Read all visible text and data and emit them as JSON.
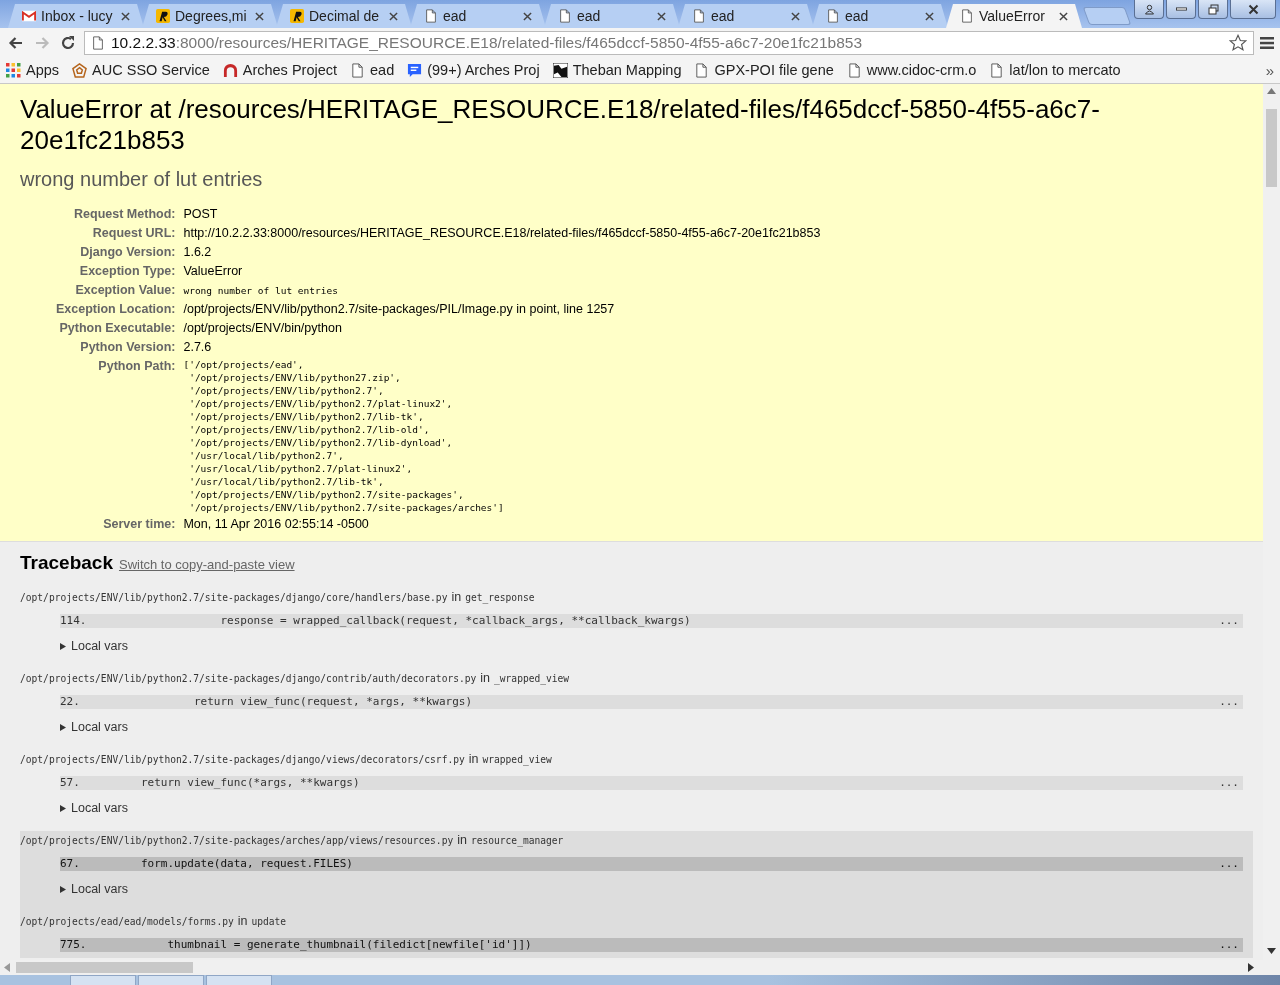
{
  "tabs": [
    {
      "title": "Inbox - lucy",
      "kind": "gmail",
      "selected": false
    },
    {
      "title": "Degrees,mi",
      "kind": "r",
      "selected": false
    },
    {
      "title": "Decimal de",
      "kind": "r",
      "selected": false
    },
    {
      "title": "ead",
      "kind": "page",
      "selected": false
    },
    {
      "title": "ead",
      "kind": "page",
      "selected": false
    },
    {
      "title": "ead",
      "kind": "page",
      "selected": false
    },
    {
      "title": "ead",
      "kind": "page",
      "selected": false
    },
    {
      "title": "ValueError",
      "kind": "page",
      "selected": true
    }
  ],
  "address_bar": {
    "host": "10.2.2.33",
    "path": ":8000/resources/HERITAGE_RESOURCE.E18/related-files/f465dccf-5850-4f55-a6c7-20e1fc21b853"
  },
  "bookmarks": [
    {
      "label": "Apps",
      "kind": "apps"
    },
    {
      "label": "AUC SSO Service",
      "kind": "pentagon"
    },
    {
      "label": "Arches Project",
      "kind": "arch"
    },
    {
      "label": "ead",
      "kind": "page"
    },
    {
      "label": "(99+) Arches Proj",
      "kind": "chat"
    },
    {
      "label": "Theban Mapping",
      "kind": "map"
    },
    {
      "label": "GPX-POI file gene",
      "kind": "page"
    },
    {
      "label": "www.cidoc-crm.o",
      "kind": "page"
    },
    {
      "label": "lat/lon to mercato",
      "kind": "page"
    }
  ],
  "bookmarks_more": "»",
  "error": {
    "title": "ValueError at /resources/HERITAGE_RESOURCE.E18/related-files/f465dccf-5850-4f55-a6c7-20e1fc21b853",
    "message": "wrong number of lut entries"
  },
  "meta": [
    {
      "label": "Request Method:",
      "value": "POST",
      "kind": "text"
    },
    {
      "label": "Request URL:",
      "value": "http://10.2.2.33:8000/resources/HERITAGE_RESOURCE.E18/related-files/f465dccf-5850-4f55-a6c7-20e1fc21b853",
      "kind": "text"
    },
    {
      "label": "Django Version:",
      "value": "1.6.2",
      "kind": "text"
    },
    {
      "label": "Exception Type:",
      "value": "ValueError",
      "kind": "text"
    },
    {
      "label": "Exception Value:",
      "value": "wrong number of lut entries",
      "kind": "code"
    },
    {
      "label": "Exception Location:",
      "value": "/opt/projects/ENV/lib/python2.7/site-packages/PIL/Image.py in point, line 1257",
      "kind": "text"
    },
    {
      "label": "Python Executable:",
      "value": "/opt/projects/ENV/bin/python",
      "kind": "text"
    },
    {
      "label": "Python Version:",
      "value": "2.7.6",
      "kind": "text"
    },
    {
      "label": "Python Path:",
      "kind": "list",
      "lines": [
        "['/opt/projects/ead',",
        " '/opt/projects/ENV/lib/python27.zip',",
        " '/opt/projects/ENV/lib/python2.7',",
        " '/opt/projects/ENV/lib/python2.7/plat-linux2',",
        " '/opt/projects/ENV/lib/python2.7/lib-tk',",
        " '/opt/projects/ENV/lib/python2.7/lib-old',",
        " '/opt/projects/ENV/lib/python2.7/lib-dynload',",
        " '/usr/local/lib/python2.7',",
        " '/usr/local/lib/python2.7/plat-linux2',",
        " '/usr/local/lib/python2.7/lib-tk',",
        " '/opt/projects/ENV/lib/python2.7/site-packages',",
        " '/opt/projects/ENV/lib/python2.7/site-packages/arches']"
      ]
    },
    {
      "label": "Server time:",
      "value": "Mon, 11 Apr 2016 02:55:14 -0500",
      "kind": "text"
    }
  ],
  "traceback": {
    "title": "Traceback",
    "switch_link": "Switch to copy-and-paste view",
    "frames": [
      {
        "file": "/opt/projects/ENV/lib/python2.7/site-packages/django/core/handlers/base.py",
        "in": "in",
        "function": "get_response",
        "kind": "django",
        "line_no": "114.",
        "code": "                    response = wrapped_callback(request, *callback_args, **callback_kwargs)",
        "more": "...",
        "local_vars": "Local vars"
      },
      {
        "file": "/opt/projects/ENV/lib/python2.7/site-packages/django/contrib/auth/decorators.py",
        "in": "in",
        "function": "_wrapped_view",
        "kind": "django",
        "line_no": "22.",
        "code": "                return view_func(request, *args, **kwargs)",
        "more": "...",
        "local_vars": "Local vars"
      },
      {
        "file": "/opt/projects/ENV/lib/python2.7/site-packages/django/views/decorators/csrf.py",
        "in": "in",
        "function": "wrapped_view",
        "kind": "django",
        "line_no": "57.",
        "code": "        return view_func(*args, **kwargs)",
        "more": "...",
        "local_vars": "Local vars"
      },
      {
        "file": "/opt/projects/ENV/lib/python2.7/site-packages/arches/app/views/resources.py",
        "in": "in",
        "function": "resource_manager",
        "kind": "user",
        "line_no": "67.",
        "code": "        form.update(data, request.FILES)",
        "more": "...",
        "local_vars": "Local vars"
      },
      {
        "file": "/opt/projects/ead/ead/models/forms.py",
        "in": "in",
        "function": "update",
        "kind": "user",
        "line_no": "775.",
        "code": "            thumbnail = generate_thumbnail(filedict[newfile['id']])",
        "more": "..."
      }
    ]
  }
}
